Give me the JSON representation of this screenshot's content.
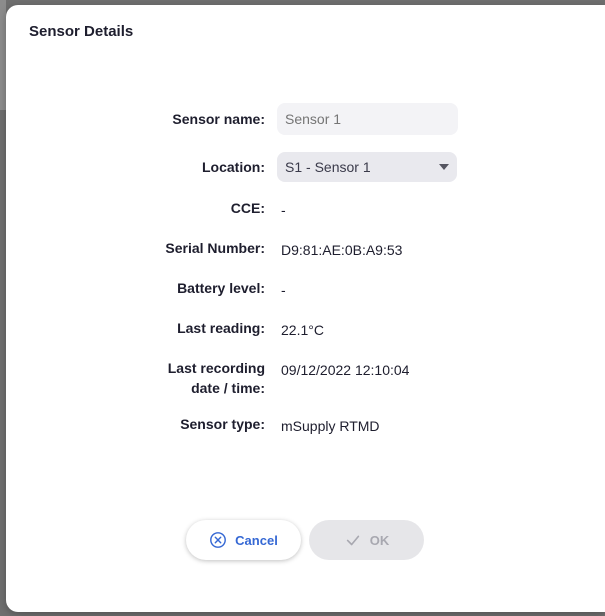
{
  "dialog": {
    "title": "Sensor Details"
  },
  "fields": {
    "sensor_name": {
      "label": "Sensor name:",
      "placeholder": "Sensor 1"
    },
    "location": {
      "label": "Location:",
      "value": "S1 - Sensor 1"
    },
    "cce": {
      "label": "CCE:",
      "value": "-"
    },
    "serial_number": {
      "label": "Serial Number:",
      "value": "D9:81:AE:0B:A9:53"
    },
    "battery_level": {
      "label": "Battery level:",
      "value": "-"
    },
    "last_reading": {
      "label": "Last reading:",
      "value": "22.1°C"
    },
    "last_recording": {
      "label_line1": "Last recording",
      "label_line2": "date / time:",
      "value": "09/12/2022 12:10:04"
    },
    "sensor_type": {
      "label": "Sensor type:",
      "value": "mSupply RTMD"
    }
  },
  "buttons": {
    "cancel": {
      "label": "Cancel",
      "icon": "x-circle-icon",
      "color": "#3568d4"
    },
    "ok": {
      "label": "OK",
      "icon": "check-icon",
      "enabled": false
    }
  }
}
